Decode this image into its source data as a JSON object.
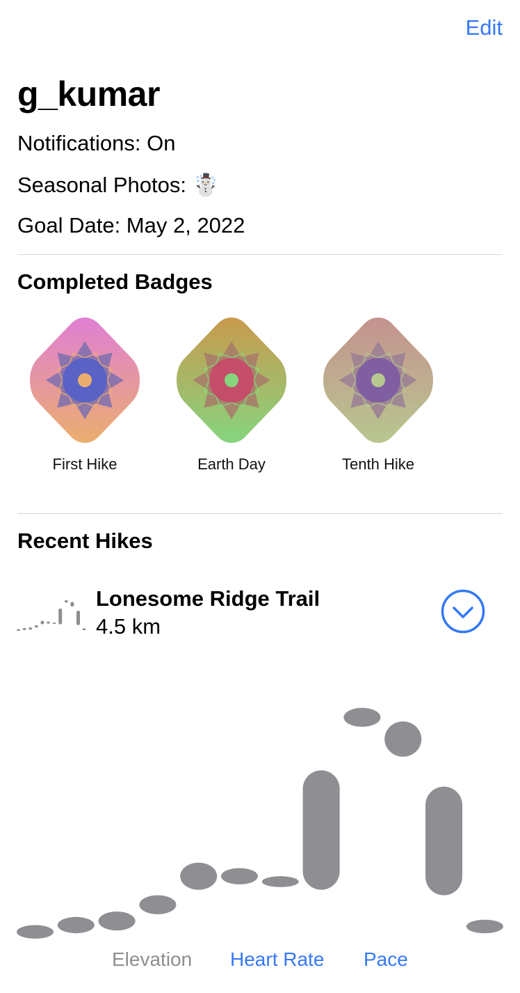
{
  "header": {
    "edit_label": "Edit"
  },
  "profile": {
    "username": "g_kumar",
    "notifications": "Notifications: On",
    "seasonal_photos": "Seasonal Photos: ☃️",
    "goal_date": "Goal Date: May 2, 2022"
  },
  "badges": {
    "title": "Completed Badges",
    "items": [
      {
        "label": "First Hike",
        "color_top": "#e07fd4",
        "color_bottom": "#eaae6e",
        "star_color": "#7d6fae",
        "center_color": "#5560c8"
      },
      {
        "label": "Earth Day",
        "color_top": "#c99a4e",
        "color_bottom": "#86d47e",
        "star_color": "#a77a6a",
        "center_color": "#c8486a"
      },
      {
        "label": "Tenth Hike",
        "color_top": "#c4928f",
        "color_bottom": "#b8c78f",
        "star_color": "#9a7f95",
        "center_color": "#7b5aa3"
      }
    ]
  },
  "recent_hikes": {
    "title": "Recent Hikes",
    "hike": {
      "name": "Lonesome Ridge Trail",
      "distance": "4.5 km"
    },
    "toggle_icon": "chevron-down-circle-icon"
  },
  "chart_data": {
    "type": "range-bar",
    "metric": "Elevation",
    "bar_color": "#8e8e93",
    "ranges": [
      [
        0.0,
        0.05
      ],
      [
        0.02,
        0.08
      ],
      [
        0.03,
        0.1
      ],
      [
        0.09,
        0.16
      ],
      [
        0.18,
        0.28
      ],
      [
        0.2,
        0.26
      ],
      [
        0.19,
        0.23
      ],
      [
        0.18,
        0.62
      ],
      [
        0.78,
        0.85
      ],
      [
        0.67,
        0.8
      ],
      [
        0.16,
        0.56
      ],
      [
        0.02,
        0.07
      ]
    ]
  },
  "metrics": {
    "options": [
      "Elevation",
      "Heart Rate",
      "Pace"
    ],
    "selected": "Elevation",
    "accent": "#3478f6",
    "muted": "#8e8e93"
  }
}
